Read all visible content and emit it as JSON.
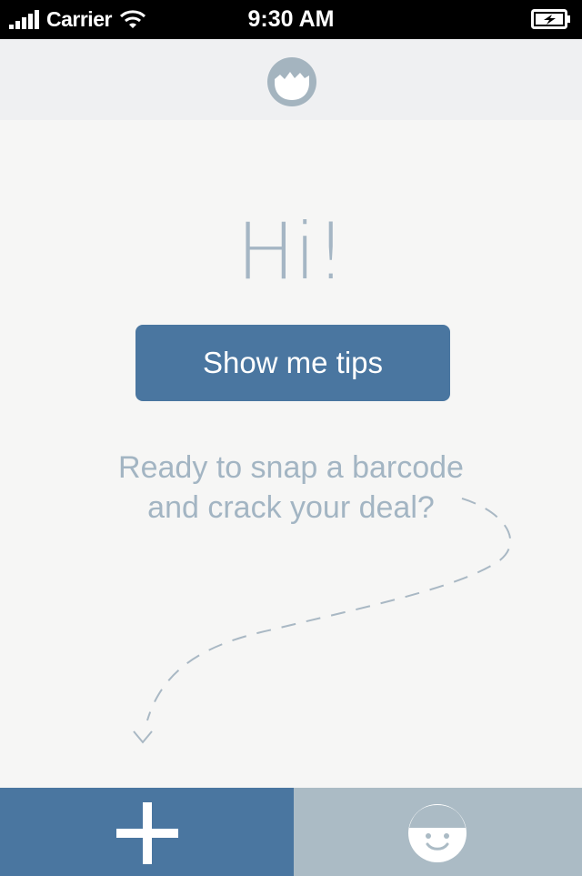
{
  "status_bar": {
    "carrier": "Carrier",
    "time": "9:30 AM",
    "icons": [
      "signal-icon",
      "wifi-icon",
      "battery-icon"
    ]
  },
  "nav_bar": {
    "logo_icon": "cracked-egg-logo-icon"
  },
  "content": {
    "greeting": "Hi!",
    "tips_button_label": "Show me tips",
    "prompt_line1": "Ready to snap a barcode",
    "prompt_line2": "and crack your deal?"
  },
  "tab_bar": {
    "add_icon": "plus-icon",
    "profile_icon": "face-icon"
  },
  "colors": {
    "primary": "#4a76a0",
    "secondary": "#abbbc5",
    "text_muted": "#a3b5c3",
    "background": "#f6f6f5"
  }
}
